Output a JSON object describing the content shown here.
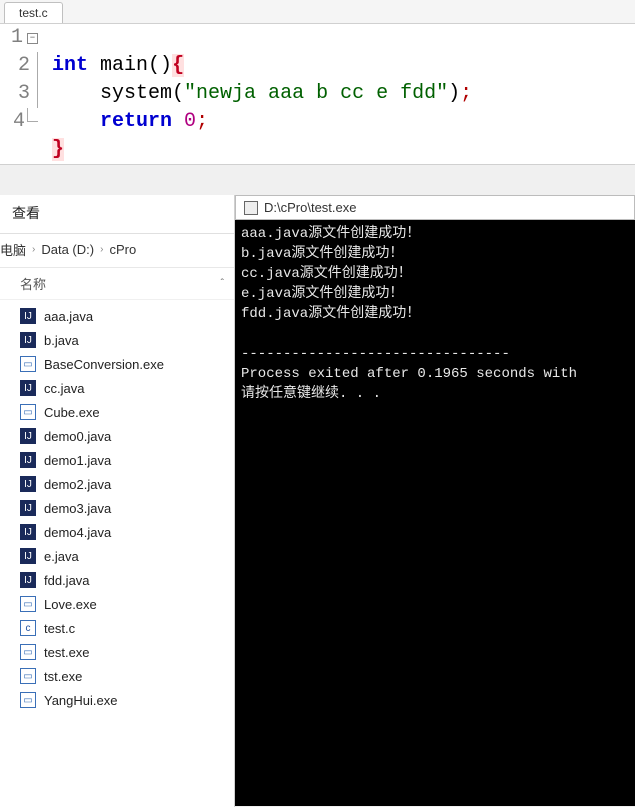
{
  "editor": {
    "tab_label": "test.c",
    "lines": {
      "l1": {
        "num": "1",
        "kw1": "int",
        "fn": "main",
        "par": "()",
        "brace": "{"
      },
      "l2": {
        "num": "2",
        "fn": "system",
        "paro": "(",
        "str": "\"newja aaa b cc e fdd\"",
        "parc": ")",
        "sc": ";"
      },
      "l3": {
        "num": "3",
        "kw": "return",
        "val": "0",
        "sc": ";"
      },
      "l4": {
        "num": "4",
        "brace": "}"
      }
    }
  },
  "explorer": {
    "view_label": "查看",
    "breadcrumb": [
      "电脑",
      "Data (D:)",
      "cPro"
    ],
    "column_header": "名称",
    "files": [
      {
        "name": "aaa.java",
        "type": "java"
      },
      {
        "name": "b.java",
        "type": "java"
      },
      {
        "name": "BaseConversion.exe",
        "type": "exe"
      },
      {
        "name": "cc.java",
        "type": "java"
      },
      {
        "name": "Cube.exe",
        "type": "exe"
      },
      {
        "name": "demo0.java",
        "type": "java"
      },
      {
        "name": "demo1.java",
        "type": "java"
      },
      {
        "name": "demo2.java",
        "type": "java"
      },
      {
        "name": "demo3.java",
        "type": "java"
      },
      {
        "name": "demo4.java",
        "type": "java"
      },
      {
        "name": "e.java",
        "type": "java"
      },
      {
        "name": "fdd.java",
        "type": "java"
      },
      {
        "name": "Love.exe",
        "type": "exe"
      },
      {
        "name": "test.c",
        "type": "c"
      },
      {
        "name": "test.exe",
        "type": "exe"
      },
      {
        "name": "tst.exe",
        "type": "exe"
      },
      {
        "name": "YangHui.exe",
        "type": "exe"
      }
    ]
  },
  "console": {
    "title": "D:\\cPro\\test.exe",
    "lines": [
      "aaa.java源文件创建成功！",
      "b.java源文件创建成功！",
      "cc.java源文件创建成功！",
      "e.java源文件创建成功！",
      "fdd.java源文件创建成功！",
      "",
      "--------------------------------",
      "Process exited after 0.1965 seconds with",
      "请按任意键继续. . ."
    ]
  },
  "icon_glyph": {
    "java": "IJ",
    "exe": "▭",
    "c": "c"
  }
}
